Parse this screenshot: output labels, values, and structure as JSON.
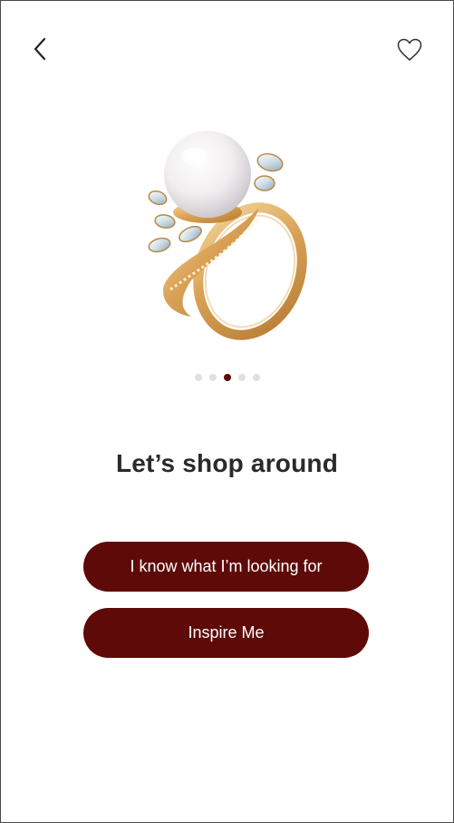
{
  "header": {
    "back_icon": "chevron-left-icon",
    "favorite_icon": "heart-outline-icon"
  },
  "carousel": {
    "image_alt": "Gold pearl ring with diamonds",
    "slide_count": 5,
    "active_index": 2
  },
  "headline": "Let’s shop around",
  "actions": {
    "primary_label": "I know what I’m looking for",
    "secondary_label": "Inspire Me"
  },
  "colors": {
    "accent": "#5e0a08",
    "dot_inactive": "#e0e0e0",
    "text": "#2a2a2a"
  }
}
